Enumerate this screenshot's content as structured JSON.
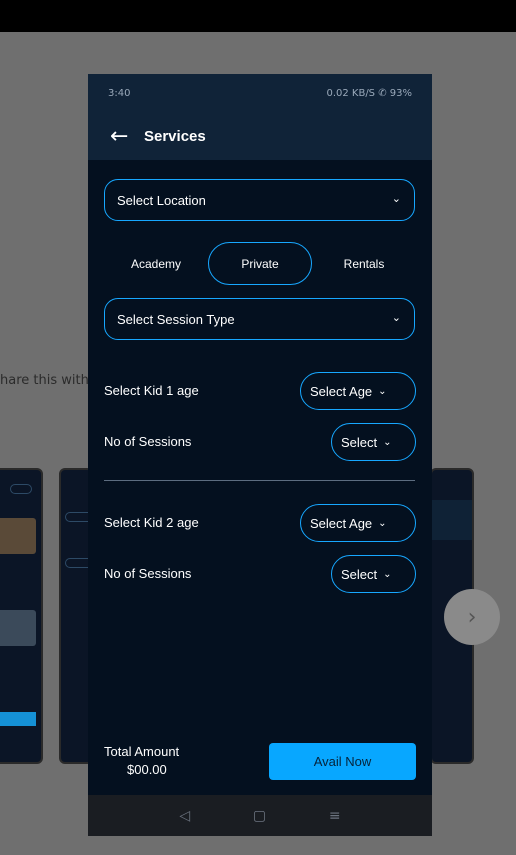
{
  "background": {
    "share_text": "hare this with"
  },
  "status_bar": {
    "time": "3:40",
    "right": "0.02 KB/S ✆ 93%"
  },
  "app_bar": {
    "title": "Services"
  },
  "location_select": {
    "label": "Select Location"
  },
  "tabs": [
    {
      "label": "Academy",
      "active": false
    },
    {
      "label": "Private",
      "active": true
    },
    {
      "label": "Rentals",
      "active": false
    }
  ],
  "session_type_select": {
    "label": "Select Session Type"
  },
  "kids": [
    {
      "age_label": "Select Kid 1 age",
      "age_select": "Select Age",
      "sessions_label": "No of Sessions",
      "sessions_select": "Select"
    },
    {
      "age_label": "Select Kid 2 age",
      "age_select": "Select Age",
      "sessions_label": "No of Sessions",
      "sessions_select": "Select"
    }
  ],
  "footer": {
    "total_label": "Total Amount",
    "total_value": "$00.00",
    "avail_button": "Avail Now"
  },
  "colors": {
    "accent": "#17a7ff",
    "button": "#08a7ff",
    "screen_bg": "#04101f",
    "header_bg": "#102338"
  }
}
